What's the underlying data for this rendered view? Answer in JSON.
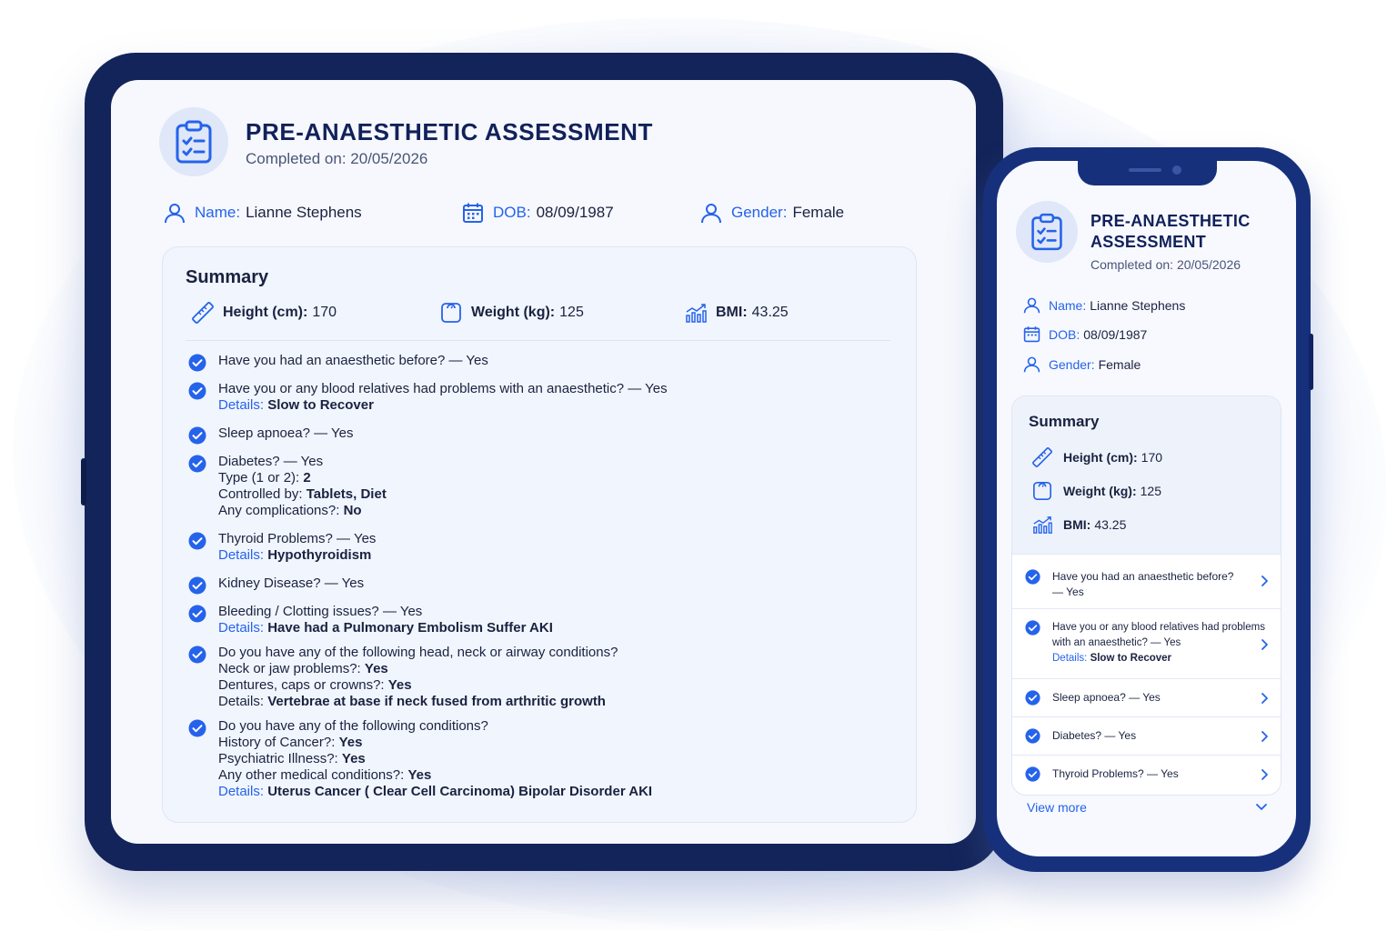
{
  "colors": {
    "accent": "#2563eb",
    "device_frame": "#13245a",
    "title": "#11215a",
    "check": "#2563eb"
  },
  "assessment": {
    "title": "PRE-ANAESTHETIC ASSESSMENT",
    "completed": "Completed on: 20/05/2026",
    "name_label": "Name:",
    "name": "Lianne Stephens",
    "dob_label": "DOB:",
    "dob": "08/09/1987",
    "gender_label": "Gender:",
    "gender": "Female"
  },
  "summary": {
    "heading": "Summary",
    "height_label": "Height (cm):",
    "height": "170",
    "weight_label": "Weight (kg):",
    "weight": "125",
    "bmi_label": "BMI:",
    "bmi": "43.25"
  },
  "questions": {
    "q1": {
      "text": "Have you had an anaesthetic before? — Yes"
    },
    "q2": {
      "text": "Have you or any blood relatives had problems with an anaesthetic? — Yes",
      "details_label": "Details:",
      "details": "Slow to Recover"
    },
    "q3": {
      "text": "Sleep apnoea? — Yes"
    },
    "q4": {
      "text": "Diabetes? — Yes",
      "type_label": "Type (1 or 2):",
      "type": "2",
      "controlled_label": "Controlled by:",
      "controlled": "Tablets, Diet",
      "complications_label": "Any complications?:",
      "complications": "No"
    },
    "q5": {
      "text": "Thyroid Problems? — Yes",
      "details_label": "Details:",
      "details": "Hypothyroidism"
    },
    "q6": {
      "text": "Kidney Disease? — Yes"
    },
    "q7": {
      "text": "Bleeding / Clotting issues? — Yes",
      "details_label": "Details:",
      "details": "Have had a Pulmonary Embolism Suffer AKI"
    },
    "q8": {
      "text": "Do you have any of the following head, neck or airway conditions?",
      "neck_label": "Neck or jaw problems?:",
      "neck": "Yes",
      "dentures_label": "Dentures, caps or crowns?:",
      "dentures": "Yes",
      "details_label": "Details:",
      "details": "Vertebrae at base if neck fused from arthritic growth"
    },
    "q9": {
      "text": "Do you have any of the following conditions?",
      "cancer_label": "History of Cancer?:",
      "cancer": "Yes",
      "psych_label": "Psychiatric Illness?:",
      "psych": "Yes",
      "other_label": "Any other medical conditions?:",
      "other": "Yes",
      "details_label": "Details:",
      "details": "Uterus Cancer ( Clear Cell Carcinoma) Bipolar Disorder AKI"
    }
  },
  "phone": {
    "title_line1": "PRE-ANAESTHETIC",
    "title_line2": "ASSESSMENT",
    "q1_line1": "Have you had an anaesthetic before?",
    "q1_line2": "— Yes",
    "q2_line1": "Have you or any blood relatives had problems",
    "q2_line2": "with an anaesthetic? — Yes",
    "q3": "Sleep apnoea? — Yes",
    "q4": "Diabetes? — Yes",
    "q5": "Thyroid Problems? — Yes",
    "view_more": "View more"
  }
}
